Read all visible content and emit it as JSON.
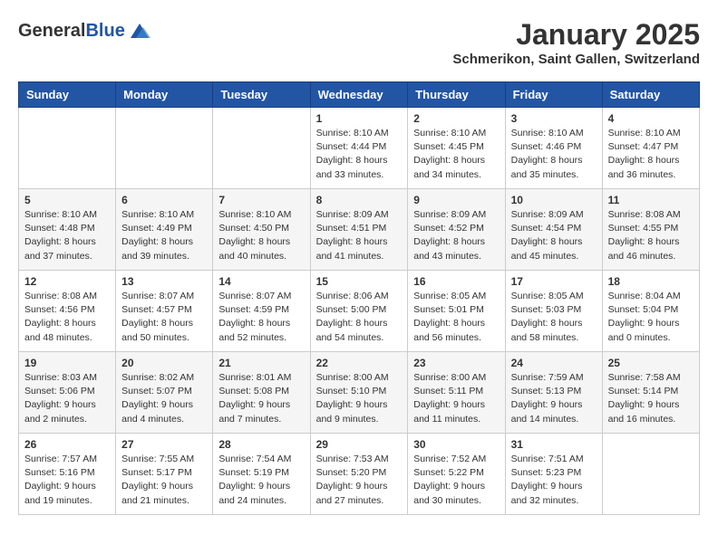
{
  "header": {
    "logo_general": "General",
    "logo_blue": "Blue",
    "month_title": "January 2025",
    "subtitle": "Schmerikon, Saint Gallen, Switzerland"
  },
  "weekdays": [
    "Sunday",
    "Monday",
    "Tuesday",
    "Wednesday",
    "Thursday",
    "Friday",
    "Saturday"
  ],
  "weeks": [
    [
      {
        "day": "",
        "info": ""
      },
      {
        "day": "",
        "info": ""
      },
      {
        "day": "",
        "info": ""
      },
      {
        "day": "1",
        "info": "Sunrise: 8:10 AM\nSunset: 4:44 PM\nDaylight: 8 hours\nand 33 minutes."
      },
      {
        "day": "2",
        "info": "Sunrise: 8:10 AM\nSunset: 4:45 PM\nDaylight: 8 hours\nand 34 minutes."
      },
      {
        "day": "3",
        "info": "Sunrise: 8:10 AM\nSunset: 4:46 PM\nDaylight: 8 hours\nand 35 minutes."
      },
      {
        "day": "4",
        "info": "Sunrise: 8:10 AM\nSunset: 4:47 PM\nDaylight: 8 hours\nand 36 minutes."
      }
    ],
    [
      {
        "day": "5",
        "info": "Sunrise: 8:10 AM\nSunset: 4:48 PM\nDaylight: 8 hours\nand 37 minutes."
      },
      {
        "day": "6",
        "info": "Sunrise: 8:10 AM\nSunset: 4:49 PM\nDaylight: 8 hours\nand 39 minutes."
      },
      {
        "day": "7",
        "info": "Sunrise: 8:10 AM\nSunset: 4:50 PM\nDaylight: 8 hours\nand 40 minutes."
      },
      {
        "day": "8",
        "info": "Sunrise: 8:09 AM\nSunset: 4:51 PM\nDaylight: 8 hours\nand 41 minutes."
      },
      {
        "day": "9",
        "info": "Sunrise: 8:09 AM\nSunset: 4:52 PM\nDaylight: 8 hours\nand 43 minutes."
      },
      {
        "day": "10",
        "info": "Sunrise: 8:09 AM\nSunset: 4:54 PM\nDaylight: 8 hours\nand 45 minutes."
      },
      {
        "day": "11",
        "info": "Sunrise: 8:08 AM\nSunset: 4:55 PM\nDaylight: 8 hours\nand 46 minutes."
      }
    ],
    [
      {
        "day": "12",
        "info": "Sunrise: 8:08 AM\nSunset: 4:56 PM\nDaylight: 8 hours\nand 48 minutes."
      },
      {
        "day": "13",
        "info": "Sunrise: 8:07 AM\nSunset: 4:57 PM\nDaylight: 8 hours\nand 50 minutes."
      },
      {
        "day": "14",
        "info": "Sunrise: 8:07 AM\nSunset: 4:59 PM\nDaylight: 8 hours\nand 52 minutes."
      },
      {
        "day": "15",
        "info": "Sunrise: 8:06 AM\nSunset: 5:00 PM\nDaylight: 8 hours\nand 54 minutes."
      },
      {
        "day": "16",
        "info": "Sunrise: 8:05 AM\nSunset: 5:01 PM\nDaylight: 8 hours\nand 56 minutes."
      },
      {
        "day": "17",
        "info": "Sunrise: 8:05 AM\nSunset: 5:03 PM\nDaylight: 8 hours\nand 58 minutes."
      },
      {
        "day": "18",
        "info": "Sunrise: 8:04 AM\nSunset: 5:04 PM\nDaylight: 9 hours\nand 0 minutes."
      }
    ],
    [
      {
        "day": "19",
        "info": "Sunrise: 8:03 AM\nSunset: 5:06 PM\nDaylight: 9 hours\nand 2 minutes."
      },
      {
        "day": "20",
        "info": "Sunrise: 8:02 AM\nSunset: 5:07 PM\nDaylight: 9 hours\nand 4 minutes."
      },
      {
        "day": "21",
        "info": "Sunrise: 8:01 AM\nSunset: 5:08 PM\nDaylight: 9 hours\nand 7 minutes."
      },
      {
        "day": "22",
        "info": "Sunrise: 8:00 AM\nSunset: 5:10 PM\nDaylight: 9 hours\nand 9 minutes."
      },
      {
        "day": "23",
        "info": "Sunrise: 8:00 AM\nSunset: 5:11 PM\nDaylight: 9 hours\nand 11 minutes."
      },
      {
        "day": "24",
        "info": "Sunrise: 7:59 AM\nSunset: 5:13 PM\nDaylight: 9 hours\nand 14 minutes."
      },
      {
        "day": "25",
        "info": "Sunrise: 7:58 AM\nSunset: 5:14 PM\nDaylight: 9 hours\nand 16 minutes."
      }
    ],
    [
      {
        "day": "26",
        "info": "Sunrise: 7:57 AM\nSunset: 5:16 PM\nDaylight: 9 hours\nand 19 minutes."
      },
      {
        "day": "27",
        "info": "Sunrise: 7:55 AM\nSunset: 5:17 PM\nDaylight: 9 hours\nand 21 minutes."
      },
      {
        "day": "28",
        "info": "Sunrise: 7:54 AM\nSunset: 5:19 PM\nDaylight: 9 hours\nand 24 minutes."
      },
      {
        "day": "29",
        "info": "Sunrise: 7:53 AM\nSunset: 5:20 PM\nDaylight: 9 hours\nand 27 minutes."
      },
      {
        "day": "30",
        "info": "Sunrise: 7:52 AM\nSunset: 5:22 PM\nDaylight: 9 hours\nand 30 minutes."
      },
      {
        "day": "31",
        "info": "Sunrise: 7:51 AM\nSunset: 5:23 PM\nDaylight: 9 hours\nand 32 minutes."
      },
      {
        "day": "",
        "info": ""
      }
    ]
  ]
}
